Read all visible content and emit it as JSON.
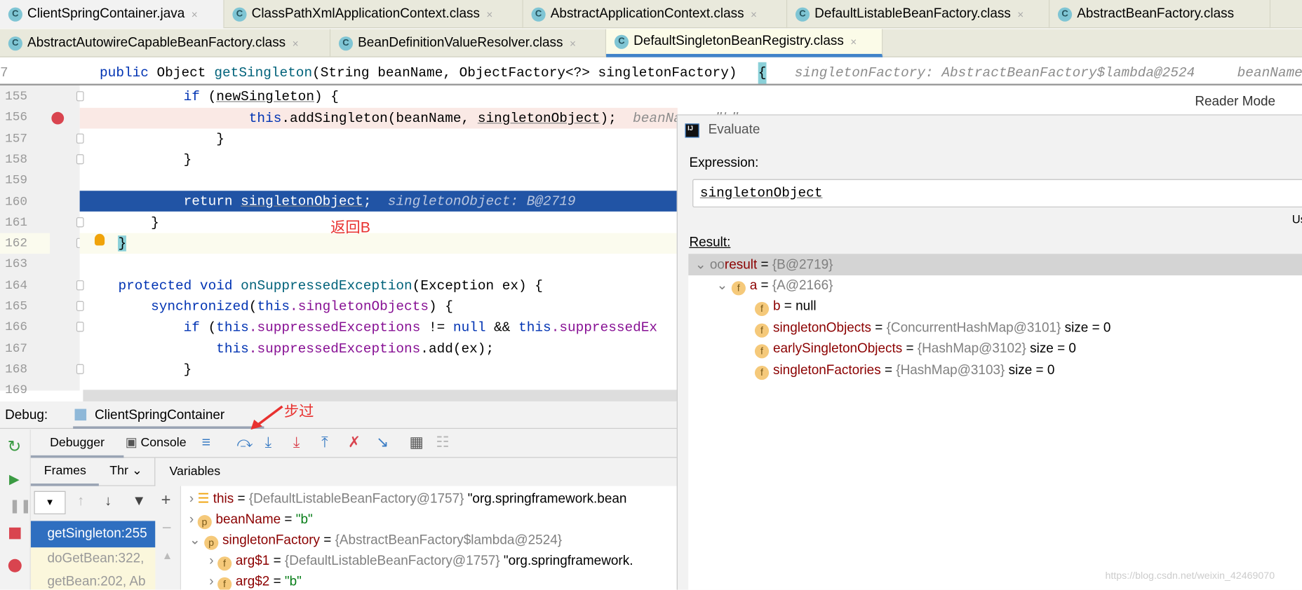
{
  "tabs_row1": [
    {
      "label": "ClientSpringContainer.java",
      "icon": "java-class-icon"
    },
    {
      "label": "ClassPathXmlApplicationContext.class",
      "icon": "class-icon"
    },
    {
      "label": "AbstractApplicationContext.class",
      "icon": "class-icon"
    },
    {
      "label": "DefaultListableBeanFactory.class",
      "icon": "class-icon"
    },
    {
      "label": "AbstractBeanFactory.class",
      "icon": "class-icon"
    }
  ],
  "tabs_row2": [
    {
      "label": "AbstractAutowireCapableBeanFactory.class",
      "icon": "class-icon"
    },
    {
      "label": "BeanDefinitionValueResolver.class",
      "icon": "class-icon"
    },
    {
      "label": "DefaultSingletonBeanRegistry.class",
      "icon": "class-icon",
      "active": true
    }
  ],
  "tab_close": "×",
  "sticky": {
    "line": "7",
    "kw": "public",
    "text1": " Object ",
    "fn": "getSingleton",
    "text2": "(String beanName, ObjectFactory<?> singletonFactory) ",
    "brace": "{",
    "hint": "singletonFactory: AbstractBeanFactory$lambda@2524",
    "hint2": "beanName"
  },
  "lines": [
    "155",
    "156",
    "157",
    "158",
    "159",
    "160",
    "161",
    "162",
    "163",
    "164",
    "165",
    "166",
    "167",
    "168",
    "169"
  ],
  "code": {
    "l155": {
      "kw": "if",
      "rest1": " (",
      "var": "newSingleton",
      "rest2": ") {"
    },
    "l156": {
      "kw": "this",
      "rest1": ".addSingleton(beanName, ",
      "var": "singletonObject",
      "rest2": ");",
      "hint": "beanName: \"b\""
    },
    "l157": "}",
    "l158": "}",
    "l160": {
      "kw": "return",
      "var": "singletonObject",
      "rest": ";",
      "hint": "singletonObject: B@2719"
    },
    "l161": "}",
    "l162": "}",
    "l164": {
      "kw": "protected void",
      "fn": "onSuppressedException",
      "rest": "(Exception ex) {"
    },
    "l165": {
      "kw": "synchronized",
      "p": "(",
      "kw2": "this",
      "fld": ".singletonObjects",
      "rest": ") {"
    },
    "l166": {
      "kw": "if",
      "p": " (",
      "kw2": "this",
      "fld": ".suppressedExceptions",
      "op": " != ",
      "kw3": "null",
      "and": " && ",
      "kw4": "this",
      "fld2": ".suppressedEx"
    },
    "l167": {
      "kw": "this",
      "fld": ".suppressedExceptions",
      "rest": ".add(ex);"
    },
    "l168": "}"
  },
  "annotation_return": "返回B",
  "annotation_step": "步过",
  "annotation_color": "#e8312f",
  "reader_mode": "Reader Mode",
  "evaluate": {
    "title": "Evaluate",
    "expression_label": "Expression:",
    "expression_value": "singletonObject",
    "use_hint": "Us",
    "result_label": "Result:",
    "tree": [
      {
        "name": "result",
        "value": "{B@2719}",
        "icon": "watch-icon",
        "expanded": true
      },
      {
        "name": "a",
        "value": "{A@2166}",
        "icon": "field-icon",
        "expanded": true
      },
      {
        "name": "b",
        "eq": " = ",
        "value": "null",
        "icon": "field-icon"
      },
      {
        "name": "singletonObjects",
        "value": "{ConcurrentHashMap@3101}",
        "extra": "size = 0",
        "icon": "static-field-icon"
      },
      {
        "name": "earlySingletonObjects",
        "value": "{HashMap@3102}",
        "extra": "size = 0",
        "icon": "static-field-icon"
      },
      {
        "name": "singletonFactories",
        "value": "{HashMap@3103}",
        "extra": "size = 0",
        "icon": "static-field-icon"
      }
    ]
  },
  "debug": {
    "label": "Debug:",
    "session": "ClientSpringContainer",
    "tabs": [
      "Debugger",
      "Console"
    ],
    "frames_tab": "Frames",
    "threads_tab": "Thr",
    "variables": "Variables",
    "frames": [
      "getSingleton:255",
      "doGetBean:322, ",
      "getBean:202, Ab"
    ],
    "vars": [
      {
        "icon": "this-icon",
        "name": "this",
        "value": "{DefaultListableBeanFactory@1757}",
        "str": "\"org.springframework.bean"
      },
      {
        "icon": "param-icon",
        "name": "beanName",
        "str": "\"b\""
      },
      {
        "icon": "param-icon",
        "name": "singletonFactory",
        "value": "{AbstractBeanFactory$lambda@2524}"
      },
      {
        "icon": "field-icon",
        "name": "arg$1",
        "value": "{DefaultListableBeanFactory@1757}",
        "str": "\"org.springframework."
      },
      {
        "icon": "field-icon",
        "name": "arg$2",
        "str": "\"b\""
      }
    ]
  },
  "watermark": "https://blog.csdn.net/weixin_42469070"
}
